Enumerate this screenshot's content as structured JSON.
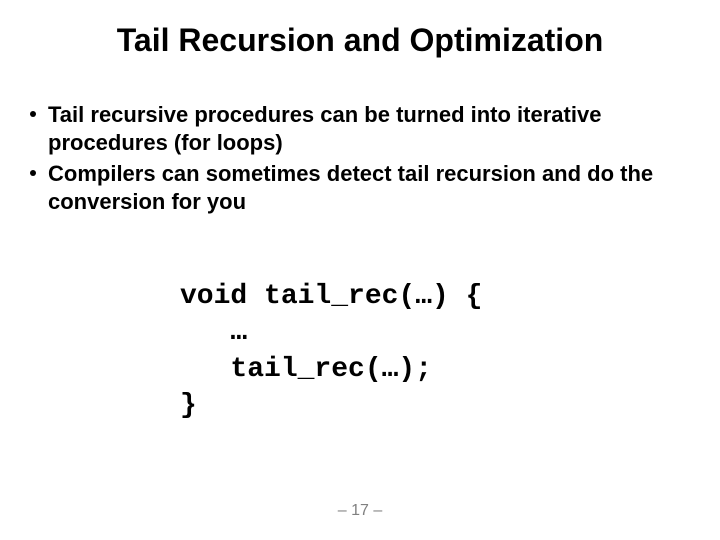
{
  "title": "Tail Recursion and Optimization",
  "bullets": [
    "Tail recursive procedures can be turned into iterative procedures (for loops)",
    "Compilers can sometimes detect tail recursion and do the conversion for you"
  ],
  "code": {
    "line1": "void tail_rec(…) {",
    "line2": "   …",
    "line3": "   tail_rec(…);",
    "line4": "}"
  },
  "pagenum": "– 17 –"
}
